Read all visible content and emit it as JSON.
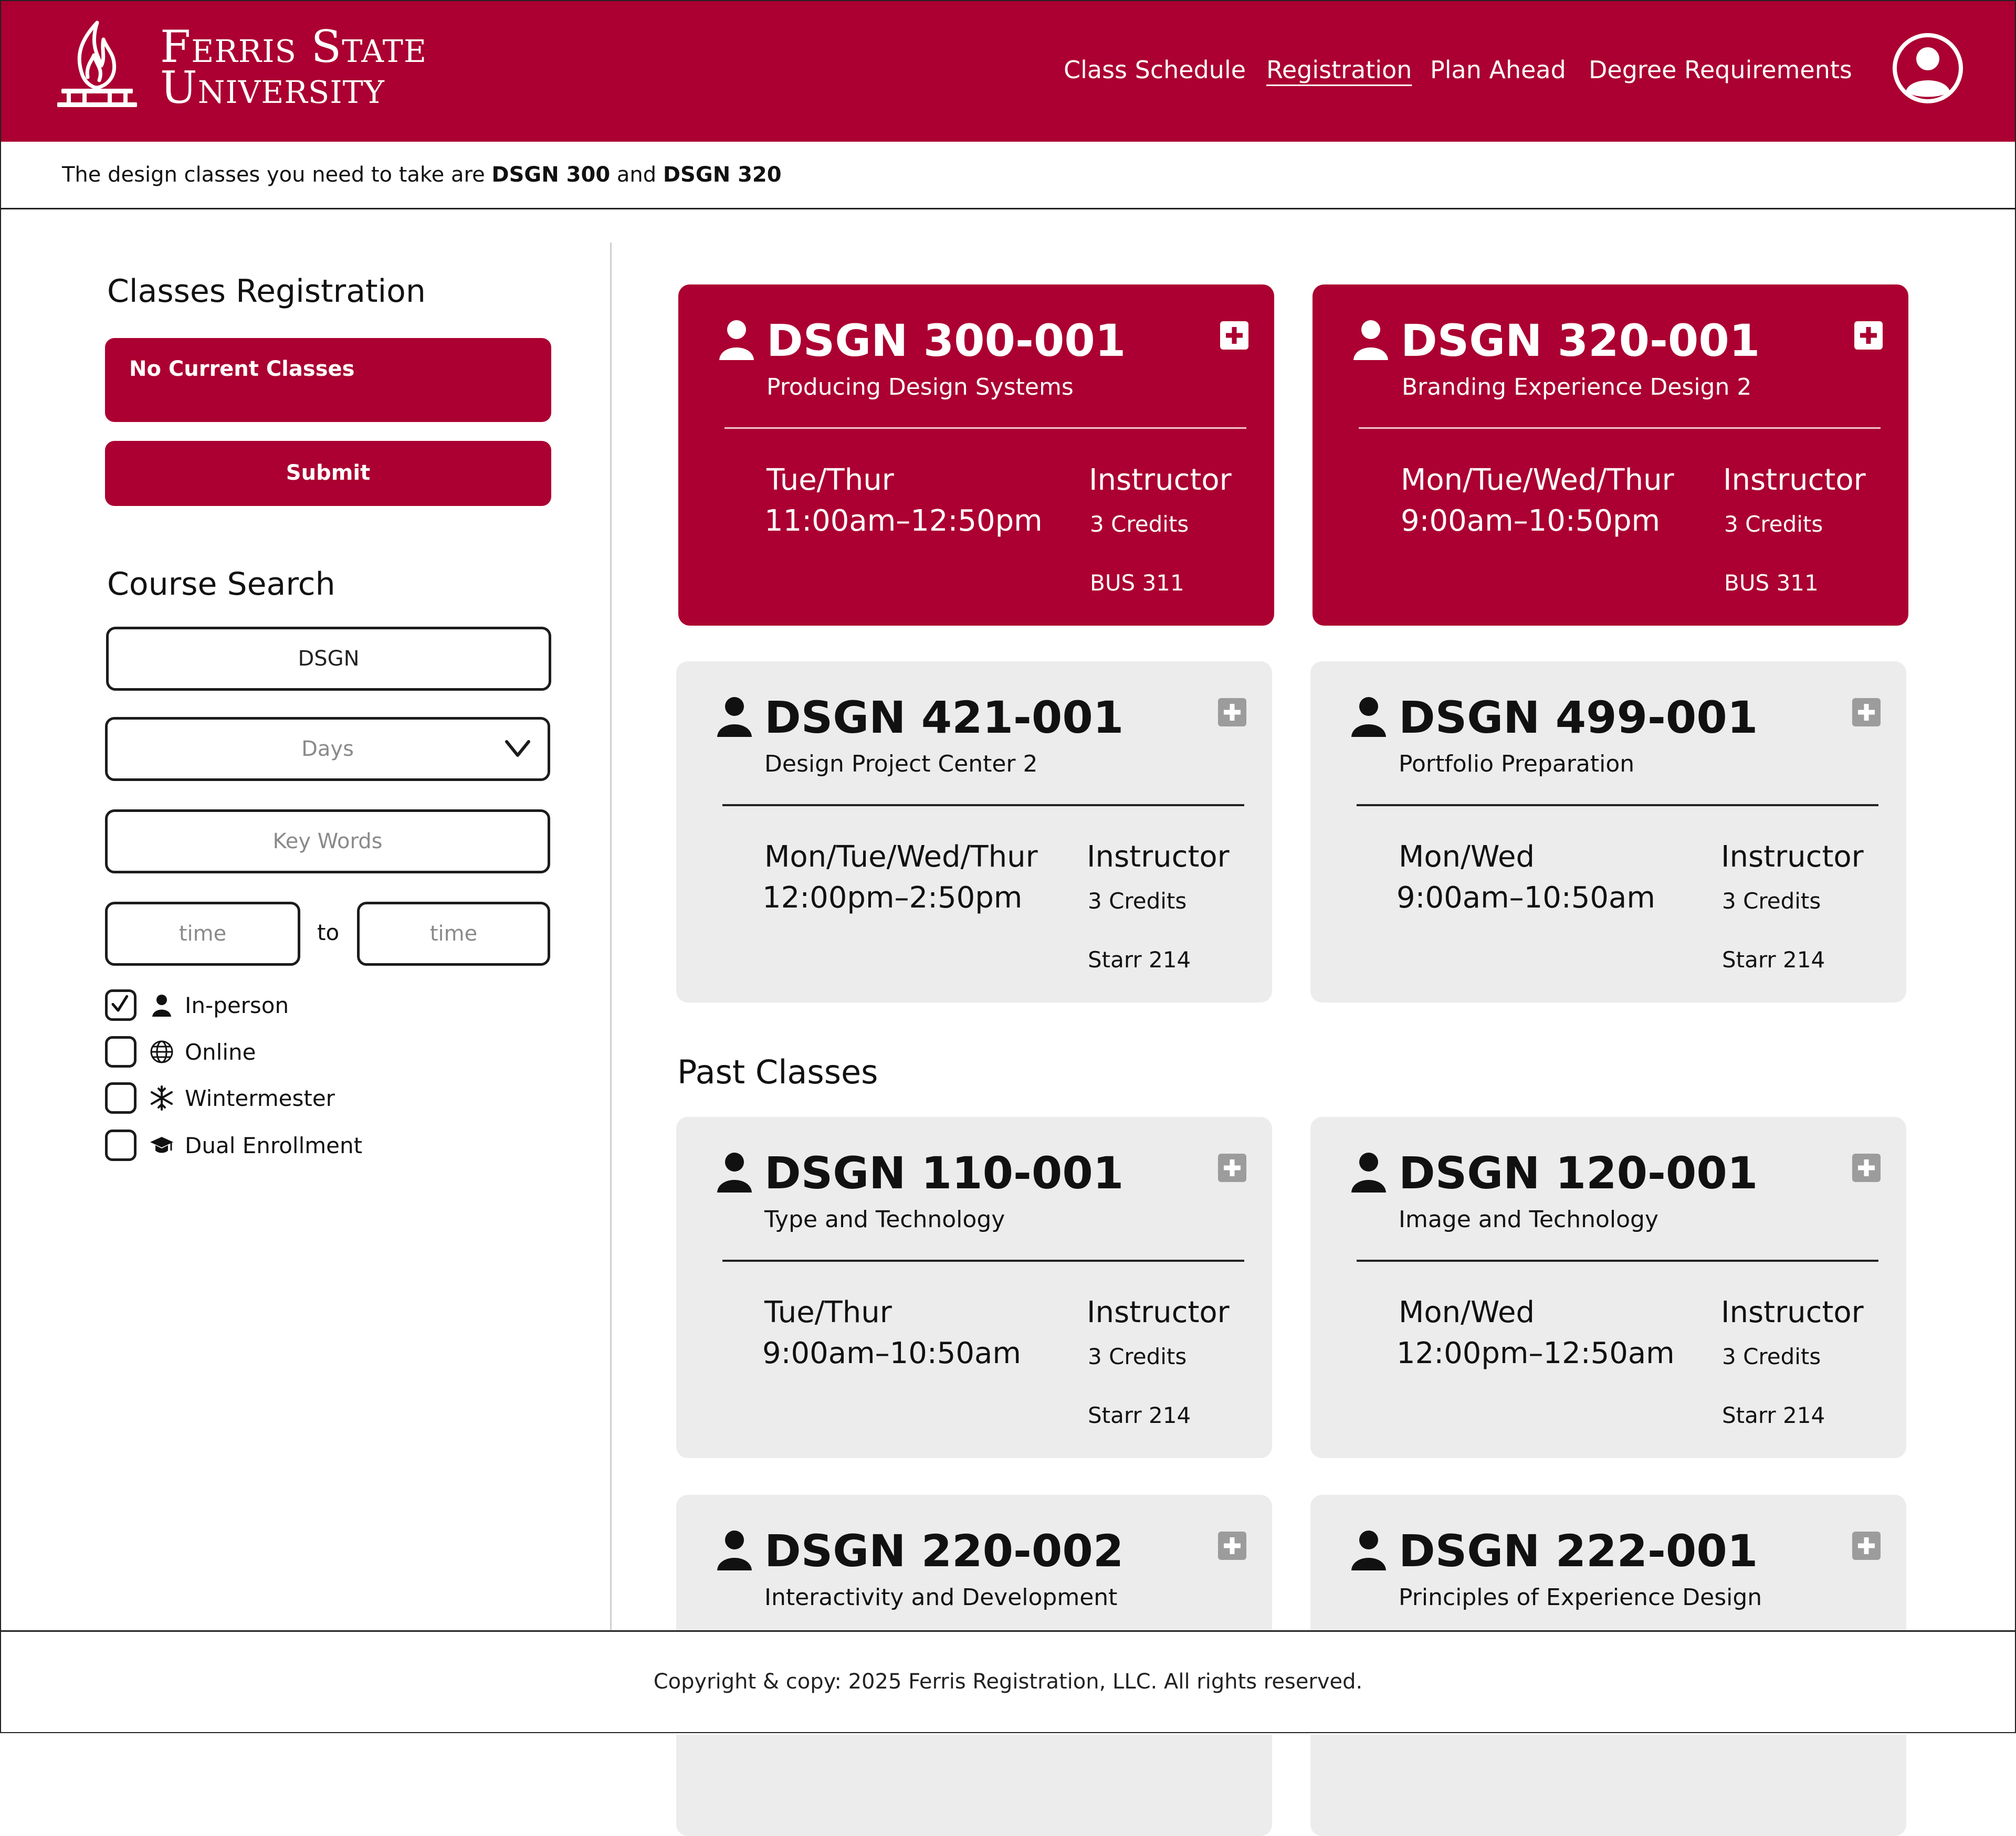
{
  "brand": {
    "line1": "Ferris State",
    "line2": "University"
  },
  "nav": {
    "class_schedule": "Class Schedule",
    "registration": "Registration",
    "plan_ahead": "Plan Ahead",
    "degree_requirements": "Degree Requirements",
    "active": "Registration"
  },
  "notice": {
    "prefix": "The design classes you need to take are ",
    "course1": "DSGN 300",
    "joiner": " and ",
    "course2": "DSGN 320"
  },
  "sidebar": {
    "registration_heading": "Classes Registration",
    "current_classes_label": "No Current Classes",
    "submit_label": "Submit",
    "search_heading": "Course Search",
    "subject_value": "DSGN",
    "days_placeholder": "Days",
    "keywords_placeholder": "Key Words",
    "time_from_placeholder": "time",
    "time_to_label": "to",
    "time_to_placeholder": "time",
    "filters": [
      {
        "label": "In-person",
        "checked": true,
        "icon": "person-icon"
      },
      {
        "label": "Online",
        "checked": false,
        "icon": "globe-icon"
      },
      {
        "label": "Wintermester",
        "checked": false,
        "icon": "snowflake-icon"
      },
      {
        "label": "Dual Enrollment",
        "checked": false,
        "icon": "graduation-cap-icon"
      }
    ]
  },
  "current_cards": [
    {
      "code": "DSGN 300-001",
      "title": "Producing Design Systems",
      "days": "Tue/Thur",
      "time": "11:00am–12:50pm",
      "instructor": "Instructor",
      "credits": "3 Credits",
      "room": "BUS 311"
    },
    {
      "code": "DSGN 320-001",
      "title": "Branding Experience Design 2",
      "days": "Mon/Tue/Wed/Thur",
      "time": "9:00am–10:50pm",
      "instructor": "Instructor",
      "credits": "3 Credits",
      "room": "BUS 311"
    }
  ],
  "available_cards": [
    {
      "code": "DSGN 421-001",
      "title": "Design Project Center 2",
      "days": "Mon/Tue/Wed/Thur",
      "time": "12:00pm–2:50pm",
      "instructor": "Instructor",
      "credits": "3 Credits",
      "room": "Starr 214"
    },
    {
      "code": "DSGN 499-001",
      "title": "Portfolio Preparation",
      "days": "Mon/Wed",
      "time": "9:00am–10:50am",
      "instructor": "Instructor",
      "credits": "3 Credits",
      "room": "Starr 214"
    }
  ],
  "past_section_title": "Past Classes",
  "past_cards": [
    {
      "code": "DSGN 110-001",
      "title": "Type and Technology",
      "days": "Tue/Thur",
      "time": "9:00am–10:50am",
      "instructor": "Instructor",
      "credits": "3 Credits",
      "room": "Starr 214"
    },
    {
      "code": "DSGN 120-001",
      "title": "Image and Technology",
      "days": "Mon/Wed",
      "time": "12:00pm–12:50am",
      "instructor": "Instructor",
      "credits": "3 Credits",
      "room": "Starr 214"
    },
    {
      "code": "DSGN 220-002",
      "title": "Interactivity and Development"
    },
    {
      "code": "DSGN 222-001",
      "title": "Principles of Experience Design"
    }
  ],
  "footer": {
    "copyright": "Copyright & copy: 2025 Ferris Registration, LLC. All rights reserved."
  },
  "colors": {
    "brand_red": "#ab0031",
    "card_gray": "#ececec",
    "icon_gray": "#9c9c9c"
  }
}
